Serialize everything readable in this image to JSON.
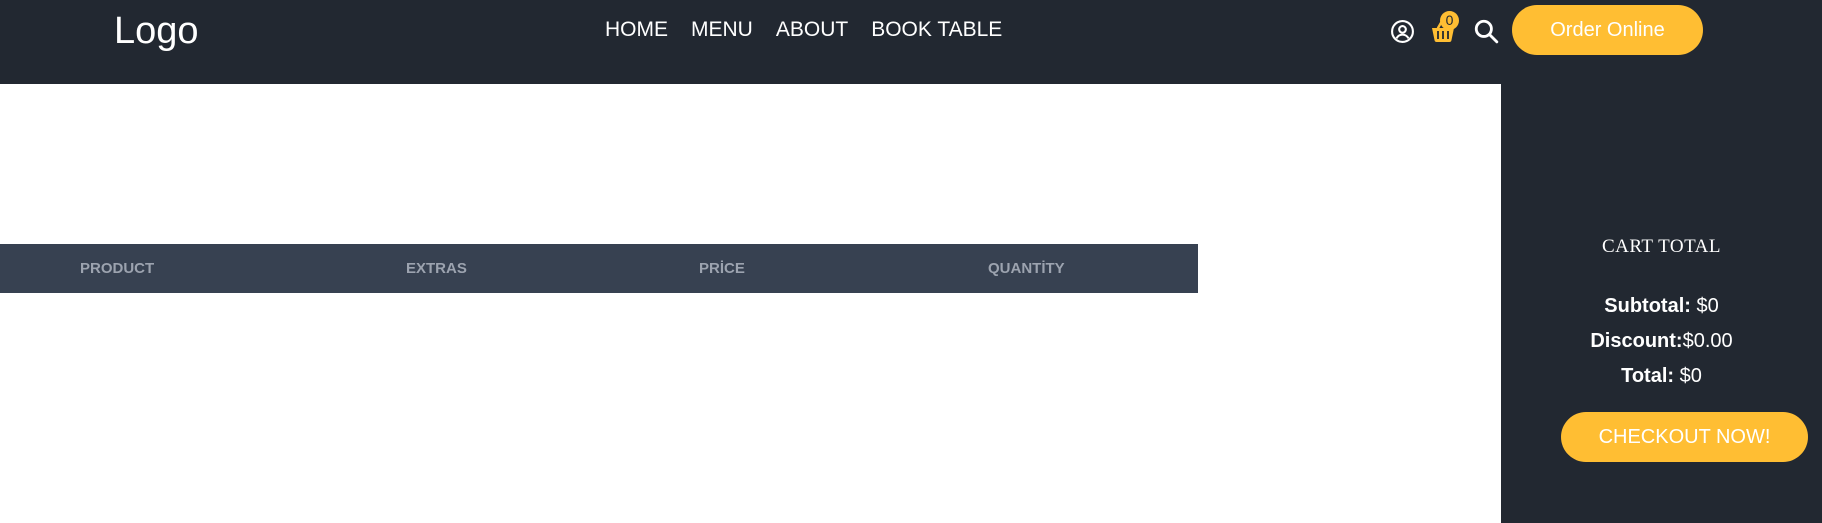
{
  "header": {
    "logo": "Logo",
    "nav": [
      "HOME",
      "MENU",
      "ABOUT",
      "BOOK TABLE"
    ],
    "cart_count": "0",
    "order_button": "Order Online",
    "icons": [
      "user-icon",
      "cart-icon",
      "search-icon"
    ]
  },
  "cart_table": {
    "columns": [
      "PRODUCT",
      "EXTRAS",
      "PRİCE",
      "QUANTİTY"
    ]
  },
  "summary": {
    "title": "CART TOTAL",
    "subtotal_label": "Subtotal:",
    "subtotal_value": " $0",
    "discount_label": "Discount:",
    "discount_value": "$0.00",
    "total_label": "Total:",
    "total_value": " $0",
    "checkout_button": "CHECKOUT NOW!"
  },
  "colors": {
    "dark": "#222831",
    "accent": "#ffbe33",
    "table_header": "#374151",
    "table_header_text": "#9ca3af"
  }
}
